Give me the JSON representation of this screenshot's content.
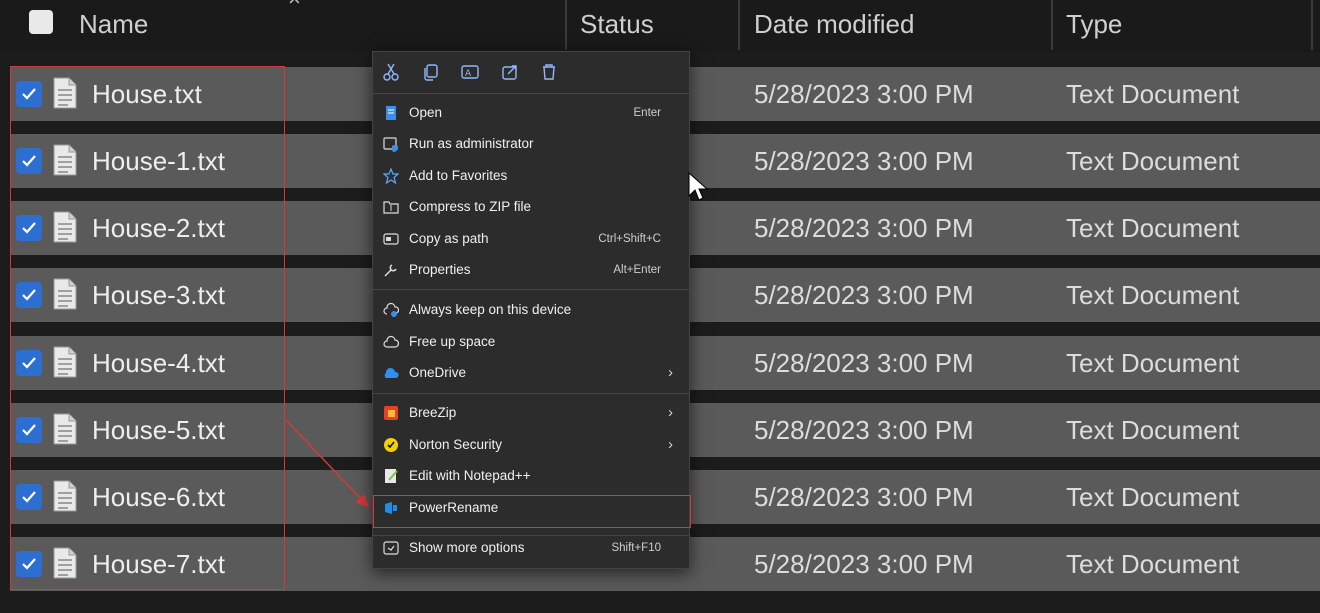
{
  "header": {
    "name": "Name",
    "status": "Status",
    "date_modified": "Date modified",
    "type": "Type"
  },
  "files": [
    {
      "name": "House.txt",
      "date": "5/28/2023 3:00 PM",
      "type": "Text Document",
      "checked": true
    },
    {
      "name": "House-1.txt",
      "date": "5/28/2023 3:00 PM",
      "type": "Text Document",
      "checked": true
    },
    {
      "name": "House-2.txt",
      "date": "5/28/2023 3:00 PM",
      "type": "Text Document",
      "checked": true
    },
    {
      "name": "House-3.txt",
      "date": "5/28/2023 3:00 PM",
      "type": "Text Document",
      "checked": true
    },
    {
      "name": "House-4.txt",
      "date": "5/28/2023 3:00 PM",
      "type": "Text Document",
      "checked": true
    },
    {
      "name": "House-5.txt",
      "date": "5/28/2023 3:00 PM",
      "type": "Text Document",
      "checked": true
    },
    {
      "name": "House-6.txt",
      "date": "5/28/2023 3:00 PM",
      "type": "Text Document",
      "checked": true
    },
    {
      "name": "House-7.txt",
      "date": "5/28/2023 3:00 PM",
      "type": "Text Document",
      "checked": true
    }
  ],
  "context_menu": {
    "toolbar": [
      "cut-icon",
      "copy-icon",
      "rename-icon",
      "share-icon",
      "delete-icon"
    ],
    "items": [
      {
        "label": "Open",
        "shortcut": "Enter",
        "icon": "open-icon"
      },
      {
        "label": "Run as administrator",
        "shortcut": "",
        "icon": "admin-shield-icon"
      },
      {
        "label": "Add to Favorites",
        "shortcut": "",
        "icon": "star-icon"
      },
      {
        "label": "Compress to ZIP file",
        "shortcut": "",
        "icon": "zip-folder-icon"
      },
      {
        "label": "Copy as path",
        "shortcut": "Ctrl+Shift+C",
        "icon": "copy-path-icon"
      },
      {
        "label": "Properties",
        "shortcut": "Alt+Enter",
        "icon": "wrench-icon"
      },
      {
        "label": "Always keep on this device",
        "shortcut": "",
        "icon": "cloud-sync-icon"
      },
      {
        "label": "Free up space",
        "shortcut": "",
        "icon": "cloud-outline-icon"
      },
      {
        "label": "OneDrive",
        "shortcut": "",
        "icon": "onedrive-icon",
        "submenu": true
      },
      {
        "label": "BreeZip",
        "shortcut": "",
        "icon": "breezip-icon",
        "submenu": true
      },
      {
        "label": "Norton Security",
        "shortcut": "",
        "icon": "norton-icon",
        "submenu": true
      },
      {
        "label": "Edit with Notepad++",
        "shortcut": "",
        "icon": "notepadpp-icon"
      },
      {
        "label": "PowerRename",
        "shortcut": "",
        "icon": "powerrename-icon",
        "highlighted": true
      },
      {
        "label": "Show more options",
        "shortcut": "Shift+F10",
        "icon": "more-options-icon"
      }
    ]
  },
  "colors": {
    "checkbox": "#2d6fd1",
    "highlight_border": "#d23a3a",
    "menu_bg": "#2c2c2c",
    "row_bg": "#5a5a5a"
  }
}
